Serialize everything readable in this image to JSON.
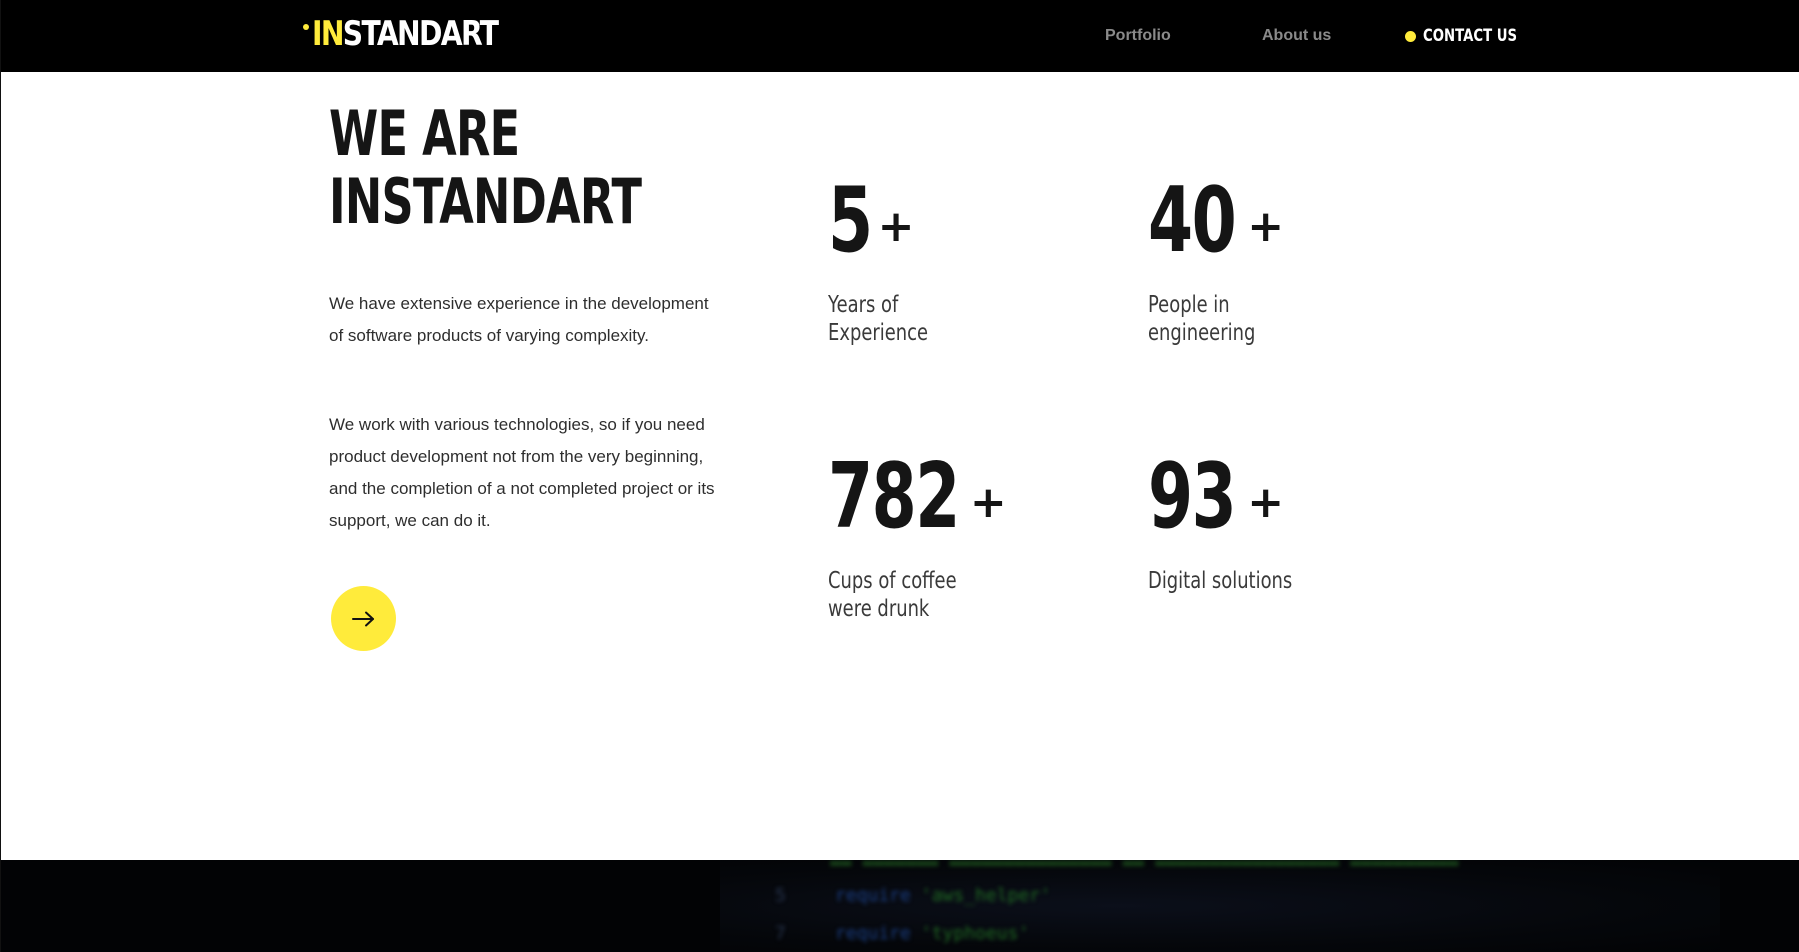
{
  "header": {
    "logo": {
      "accent": "IN",
      "rest": "STANDART"
    },
    "nav": {
      "portfolio": "Portfolio",
      "about": "About us",
      "contact": "CONTACT US"
    }
  },
  "hero": {
    "headline_lines": [
      "WE ARE",
      "INSTANDART"
    ],
    "paragraph_1": "We have extensive experience in the development of software products of varying complexity.",
    "paragraph_2": "We work with various technologies, so if you need product development not from the very beginning, and the completion of a not completed project or its support, we can do it."
  },
  "stats": [
    {
      "value": "5",
      "suffix": "+",
      "label_lines": [
        "Years of",
        "Experience"
      ]
    },
    {
      "value": "40",
      "suffix": "+",
      "label_lines": [
        "People in",
        "engineering"
      ]
    },
    {
      "value": "782",
      "suffix": "+",
      "label_lines": [
        "Cups of coffee",
        "were drunk"
      ]
    },
    {
      "value": "93",
      "suffix": "+",
      "label_lines": [
        "Digital solutions"
      ]
    }
  ],
  "code_band": {
    "lines": [
      {
        "number": "5",
        "keyword": "require",
        "value": "'aws_helper'"
      },
      {
        "number": "7",
        "keyword": "require",
        "value": "'typhoeus'"
      }
    ]
  },
  "colors": {
    "accent": "#ffeb3b",
    "header_bg": "#000000",
    "text_dark": "#151515"
  },
  "icons": {
    "cta": "arrow-right-icon"
  }
}
